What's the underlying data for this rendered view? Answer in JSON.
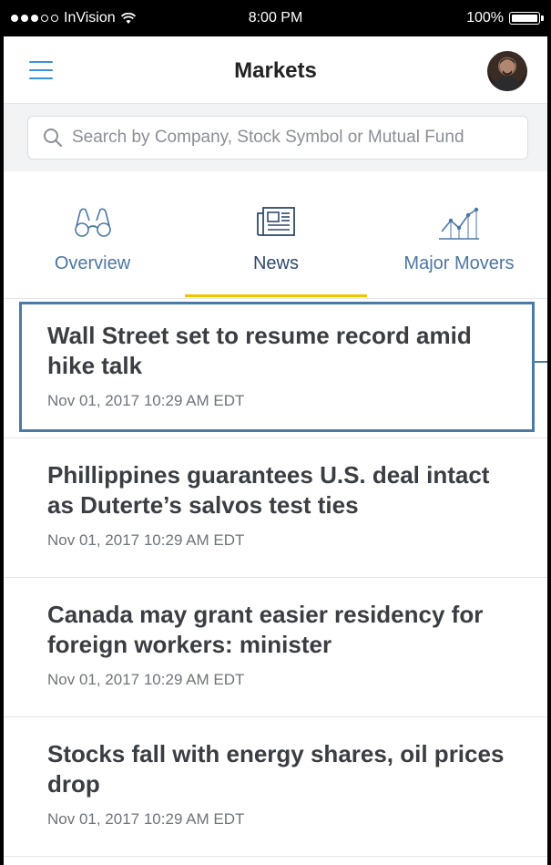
{
  "status_bar": {
    "carrier": "InVision",
    "time": "8:00 PM",
    "battery": "100%"
  },
  "nav": {
    "title": "Markets",
    "menu_icon": "hamburger-icon",
    "avatar_icon": "user-avatar"
  },
  "search": {
    "placeholder": "Search by Company, Stock Symbol or Mutual Fund",
    "value": ""
  },
  "tabs": [
    {
      "label": "Overview",
      "icon": "binoculars-icon",
      "active": false
    },
    {
      "label": "News",
      "icon": "newspaper-icon",
      "active": true
    },
    {
      "label": "Major Movers",
      "icon": "line-chart-icon",
      "active": false
    }
  ],
  "news": [
    {
      "headline": "Wall Street set to resume record amid hike talk",
      "date": "Nov 01, 2017 10:29 AM EDT"
    },
    {
      "headline": "Phillippines guarantees U.S. deal intact as Duterte’s salvos test ties",
      "date": "Nov 01, 2017 10:29 AM EDT"
    },
    {
      "headline": "Canada may grant easier residency for foreign workers: minister",
      "date": "Nov 01, 2017 10:29 AM EDT"
    },
    {
      "headline": "Stocks fall with energy shares, oil prices drop",
      "date": "Nov 01, 2017 10:29 AM EDT"
    }
  ],
  "colors": {
    "accent": "#3d8fe0",
    "tab_underline": "#f2c200",
    "highlight_border": "#4a7aa6"
  }
}
